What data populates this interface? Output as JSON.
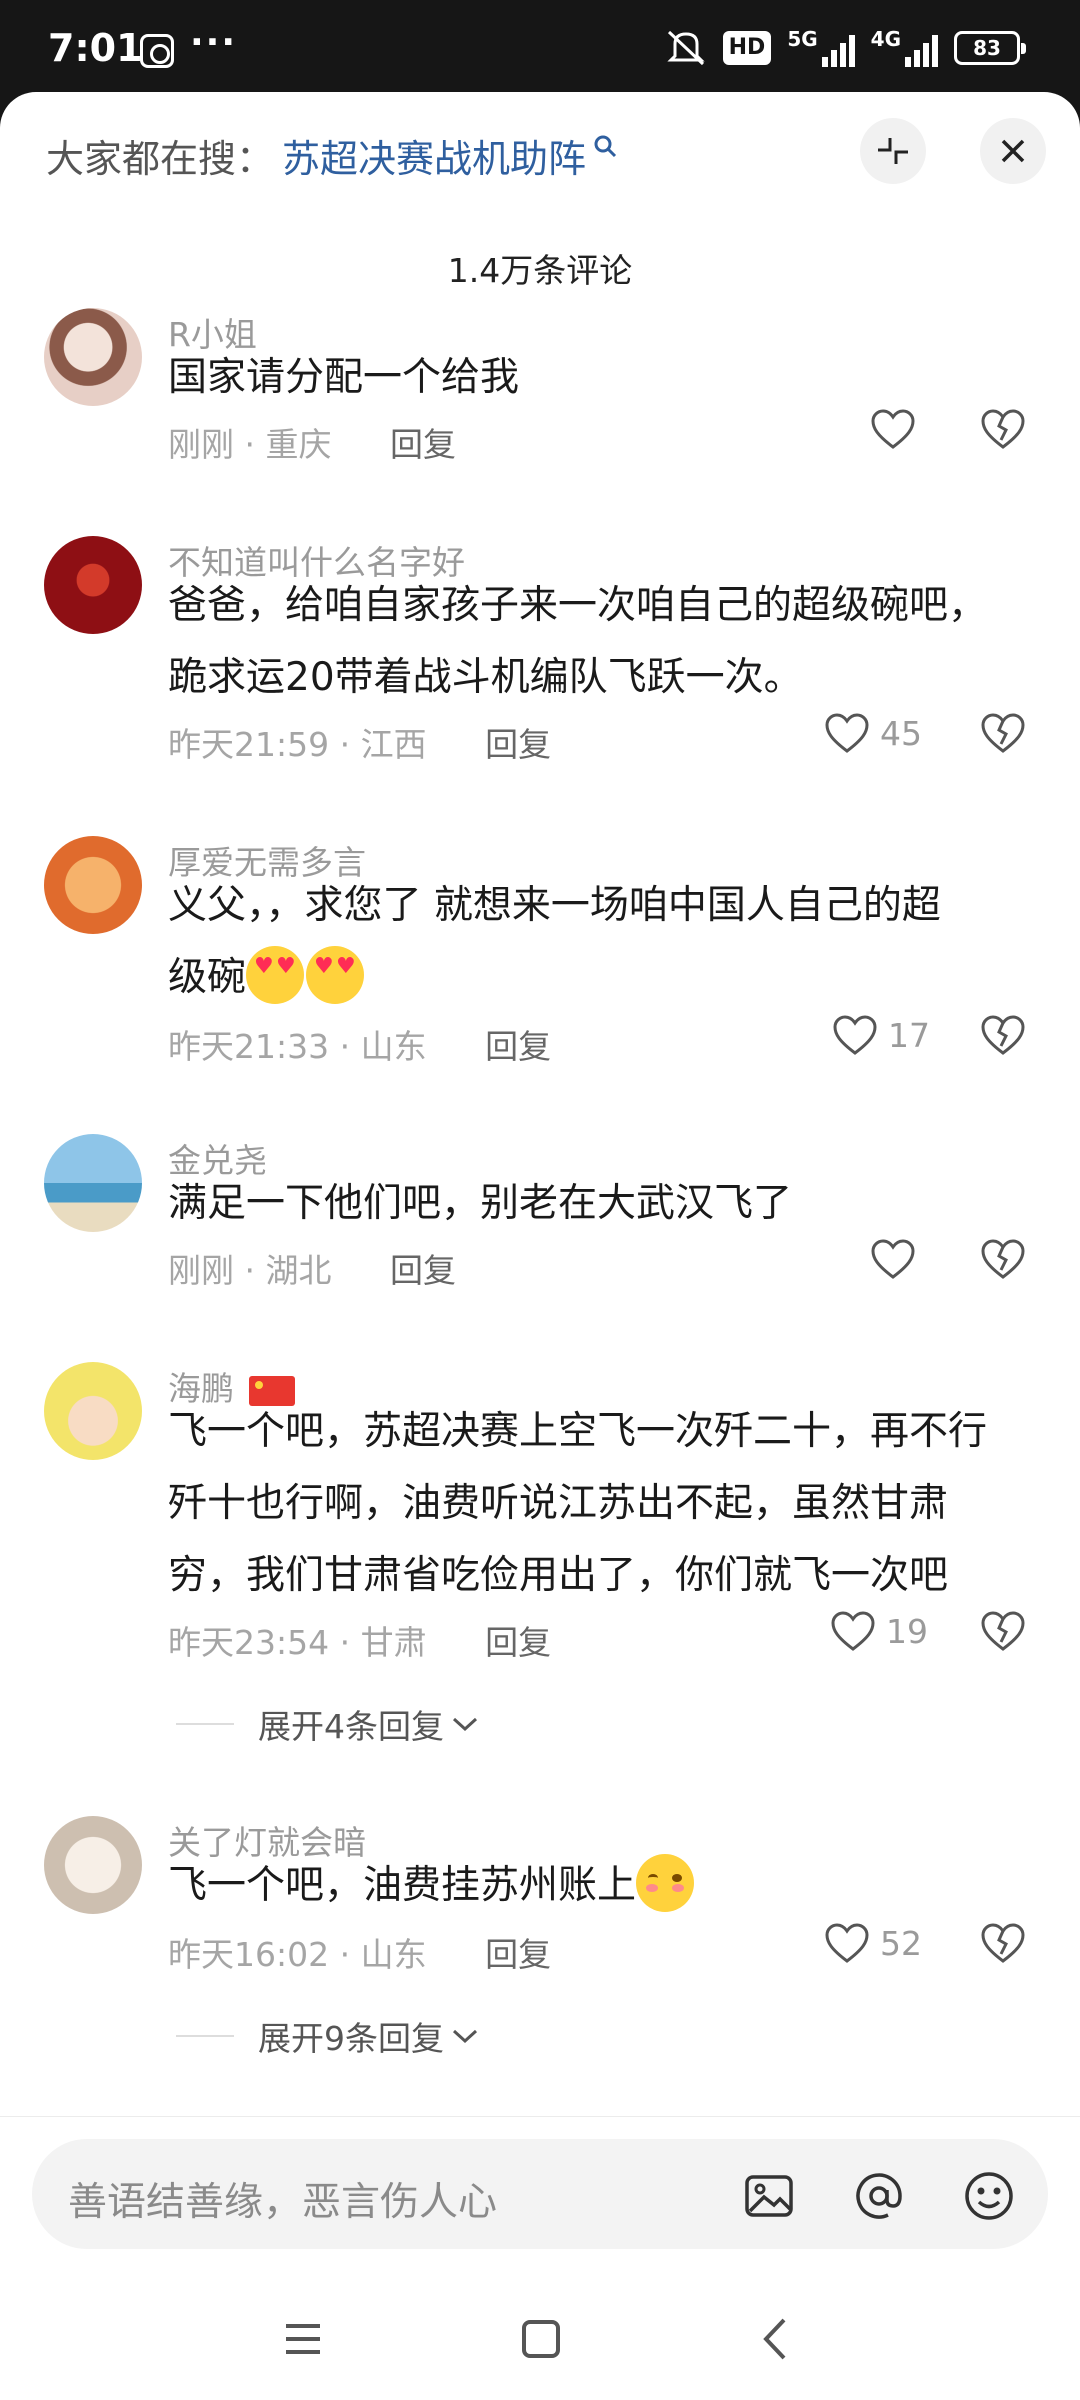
{
  "status_bar": {
    "time": "7:01",
    "more": "···",
    "hd": "HD",
    "net1": "5G",
    "net2": "4G",
    "battery": "83"
  },
  "header": {
    "search_prefix": "大家都在搜：",
    "search_term": "苏超决赛战机助阵",
    "comment_count": "1.4万条评论"
  },
  "comments": [
    {
      "user": "R小姐",
      "lines": [
        "国家请分配一个给我"
      ],
      "time": "刚刚",
      "location": "重庆",
      "reply": "回复",
      "likes": ""
    },
    {
      "user": "不知道叫什么名字好",
      "lines": [
        "爸爸，给咱自家孩子来一次咱自己的超级碗吧，",
        "跪求运20带着战斗机编队飞跃一次。"
      ],
      "time": "昨天21:59",
      "location": "江西",
      "reply": "回复",
      "likes": "45"
    },
    {
      "user": "厚爱无需多言",
      "lines": [
        "义父，，求您了   就想来一场咱中国人自己的超",
        "级碗"
      ],
      "time": "昨天21:33",
      "location": "山东",
      "reply": "回复",
      "likes": "17"
    },
    {
      "user": "金兑尧",
      "lines": [
        "满足一下他们吧，别老在大武汉飞了"
      ],
      "time": "刚刚",
      "location": "湖北",
      "reply": "回复",
      "likes": ""
    },
    {
      "user": "海鹏",
      "lines": [
        "飞一个吧，苏超决赛上空飞一次歼二十，再不行",
        "歼十也行啊，油费听说江苏出不起，虽然甘肃",
        "穷，我们甘肃省吃俭用出了，你们就飞一次吧"
      ],
      "time": "昨天23:54",
      "location": "甘肃",
      "reply": "回复",
      "likes": "19",
      "expand": "展开4条回复"
    },
    {
      "user": "关了灯就会暗",
      "lines": [
        "飞一个吧，油费挂苏州账上"
      ],
      "time": "昨天16:02",
      "location": "山东",
      "reply": "回复",
      "likes": "52",
      "expand": "展开9条回复"
    }
  ],
  "input": {
    "placeholder": "善语结善缘，恶言伤人心"
  },
  "colors": {
    "accent_link": "#2f5f9f",
    "status_bar_bg": "#161616"
  },
  "icons": [
    "search-icon",
    "collapse-icon",
    "close-icon",
    "heart-icon",
    "dislike-heart-icon",
    "image-icon",
    "at-icon",
    "emoji-icon",
    "menu-icon",
    "home-icon",
    "back-icon"
  ]
}
